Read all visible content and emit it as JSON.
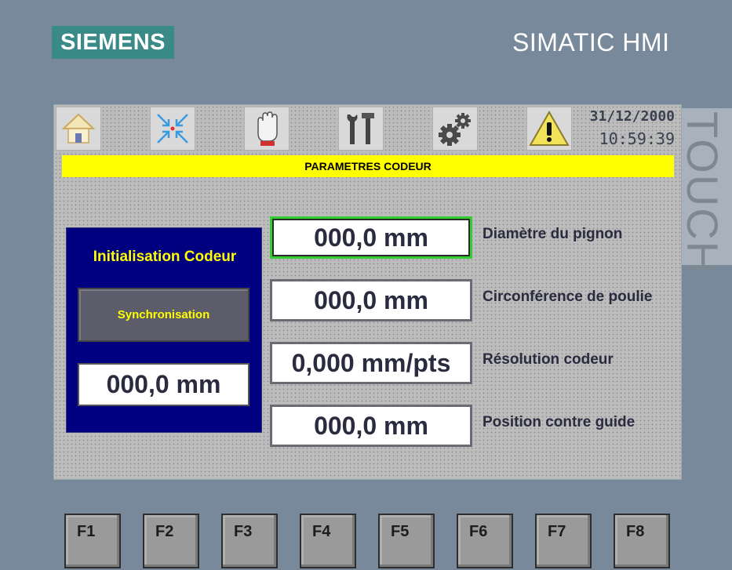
{
  "device": {
    "brand": "SIEMENS",
    "model": "SIMATIC HMI",
    "side_label": "TOUCH"
  },
  "toolbar": {
    "buttons": [
      {
        "name": "home-button",
        "icon": "home-icon"
      },
      {
        "name": "encoder-button",
        "icon": "arrows-in-icon"
      },
      {
        "name": "manual-button",
        "icon": "hand-icon"
      },
      {
        "name": "tools-button",
        "icon": "tools-icon"
      },
      {
        "name": "settings-button",
        "icon": "gears-icon"
      },
      {
        "name": "alarm-button",
        "icon": "warning-icon"
      }
    ],
    "date": "31/12/2000",
    "time": "10:59:39"
  },
  "screen": {
    "title": "PARAMETRES CODEUR"
  },
  "init_panel": {
    "title": "Initialisation Codeur",
    "sync_label": "Synchronisation",
    "value": "000,0 mm"
  },
  "fields": [
    {
      "value": "000,0 mm",
      "label": "Diamètre du pignon"
    },
    {
      "value": "000,0 mm",
      "label": "Circonférence de poulie"
    },
    {
      "value": "0,000 mm/pts",
      "label": "Résolution codeur"
    },
    {
      "value": "000,0 mm",
      "label": "Position contre guide"
    }
  ],
  "function_keys": [
    "F1",
    "F2",
    "F3",
    "F4",
    "F5",
    "F6",
    "F7",
    "F8"
  ],
  "colors": {
    "title_bar": "#ffff00",
    "init_panel": "#000080",
    "active_field_border": "#33cc33",
    "brand_logo": "#3a8a87"
  }
}
